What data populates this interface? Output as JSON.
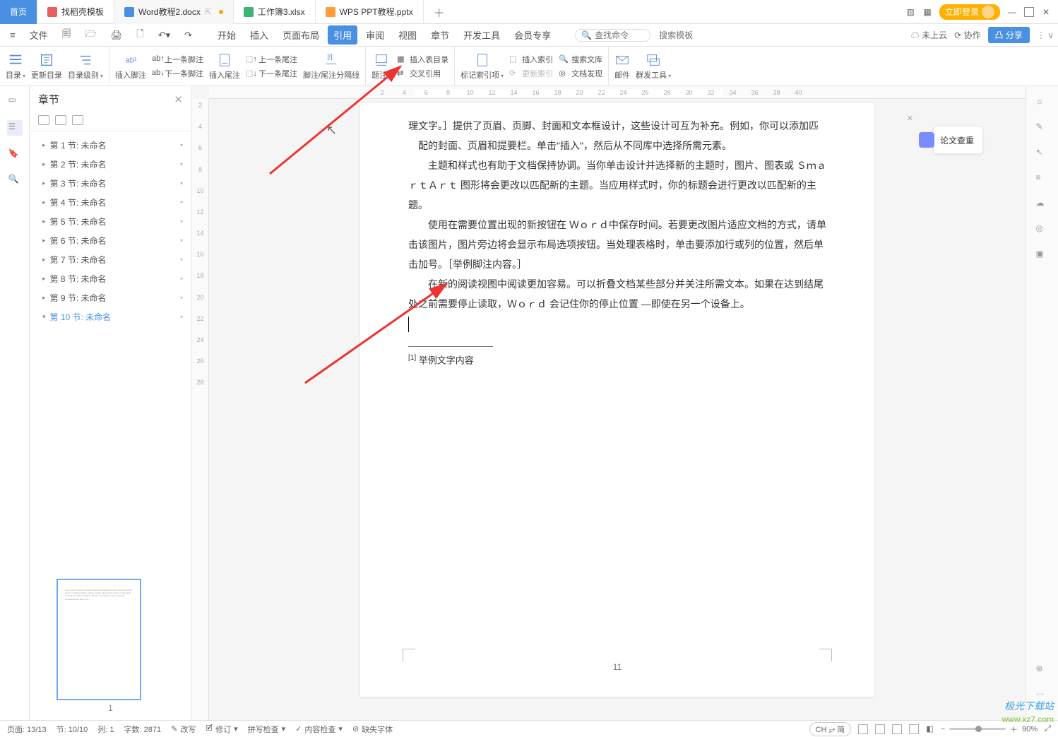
{
  "tabs": {
    "home": "首页",
    "items": [
      {
        "label": "找稻壳模板",
        "icon": "red"
      },
      {
        "label": "Word教程2.docx",
        "icon": "blue",
        "active": true,
        "modified": true
      },
      {
        "label": "工作簿3.xlsx",
        "icon": "green"
      },
      {
        "label": "WPS PPT教程.pptx",
        "icon": "orange"
      }
    ]
  },
  "window": {
    "login": "立即登录"
  },
  "menu": {
    "file": "文件",
    "items": [
      "开始",
      "插入",
      "页面布局",
      "引用",
      "审阅",
      "视图",
      "章节",
      "开发工具",
      "会员专享"
    ],
    "active_index": 3,
    "search_placeholder": "查找命令",
    "template_placeholder": "搜索模板",
    "cloud": "未上云",
    "coop": "协作",
    "share": "分享"
  },
  "ribbon": {
    "g1": {
      "toc": "目录",
      "update": "更新目录",
      "level": "目录级别"
    },
    "g2": {
      "insert_fn": "插入脚注",
      "prev_fn": "上一条脚注",
      "next_fn": "下一条脚注",
      "insert_en": "插入尾注",
      "prev_en": "上一条尾注",
      "next_en": "下一条尾注",
      "separator": "脚注/尾注分隔线"
    },
    "g3": {
      "caption": "题注",
      "insert_table_toc": "插入表目录",
      "cross_ref": "交叉引用"
    },
    "g4": {
      "mark_entry": "标记索引项",
      "insert_index": "插入索引",
      "update_index": "更新索引",
      "search_lib": "搜索文库",
      "doc_discover": "文档发现"
    },
    "g5": {
      "mail": "邮件",
      "group_send": "群发工具"
    }
  },
  "left_rail": {},
  "nav": {
    "title": "章节",
    "chapters": [
      "第 1 节: 未命名",
      "第 2 节: 未命名",
      "第 3 节: 未命名",
      "第 4 节: 未命名",
      "第 5 节: 未命名",
      "第 6 节: 未命名",
      "第 7 节: 未命名",
      "第 8 节: 未命名",
      "第 9 节: 未命名",
      "第 10 节: 未命名"
    ],
    "selected_index": 9,
    "thumb_number": "1"
  },
  "hruler": [
    "2",
    "4",
    "6",
    "8",
    "10",
    "12",
    "14",
    "16",
    "18",
    "20",
    "22",
    "24",
    "26",
    "28",
    "30",
    "32",
    "34",
    "36",
    "38",
    "40"
  ],
  "vruler": [
    "2",
    "4",
    "6",
    "8",
    "10",
    "12",
    "14",
    "16",
    "18",
    "20",
    "22",
    "24",
    "26",
    "28",
    "",
    "",
    "",
    "",
    "",
    "",
    "",
    "",
    "",
    "",
    "",
    "",
    "",
    "",
    ""
  ],
  "document": {
    "p1": "理文字。］提供了页眉、页脚、封面和文本框设计，这些设计可互为补充。例如，你可以添加匹配的封面、页眉和提要栏。单击\"插入\"，然后从不同库中选择所需元素。",
    "p2": "主题和样式也有助于文档保持协调。当你单击设计并选择新的主题时，图片、图表或  ＳｍａｒｔＡｒｔ  图形将会更改以匹配新的主题。当应用样式时，你的标题会进行更改以匹配新的主题。",
    "p3": "使用在需要位置出现的新按钮在  Ｗｏｒｄ中保存时间。若要更改图片适应文档的方式，请单击该图片，图片旁边将会显示布局选项按钮。当处理表格时，单击要添加行或列的位置，然后单击加号。［举例脚注内容。］",
    "p4": "在新的阅读视图中阅读更加容易。可以折叠文档某些部分并关注所需文本。如果在达到结尾处之前需要停止读取，Ｗｏｒｄ  会记住你的停止位置  —即使在另一个设备上。",
    "footnote_marker": "[1]",
    "footnote_text": "举例文字内容",
    "page_number": "11"
  },
  "paper_check": {
    "label": "论文查重"
  },
  "status": {
    "page": "页面: 13/13",
    "section": "节: 10/10",
    "row": "列: 1",
    "words": "字数: 2871",
    "rewrite": "改写",
    "revision": "修订",
    "spell": "拼写检查",
    "content": "内容检查",
    "missing_font": "缺失字体",
    "ime": "CH ⥂ 简",
    "zoom": "90%"
  },
  "watermark": {
    "brand": "极光下载站",
    "url": "www.xz7.com"
  }
}
